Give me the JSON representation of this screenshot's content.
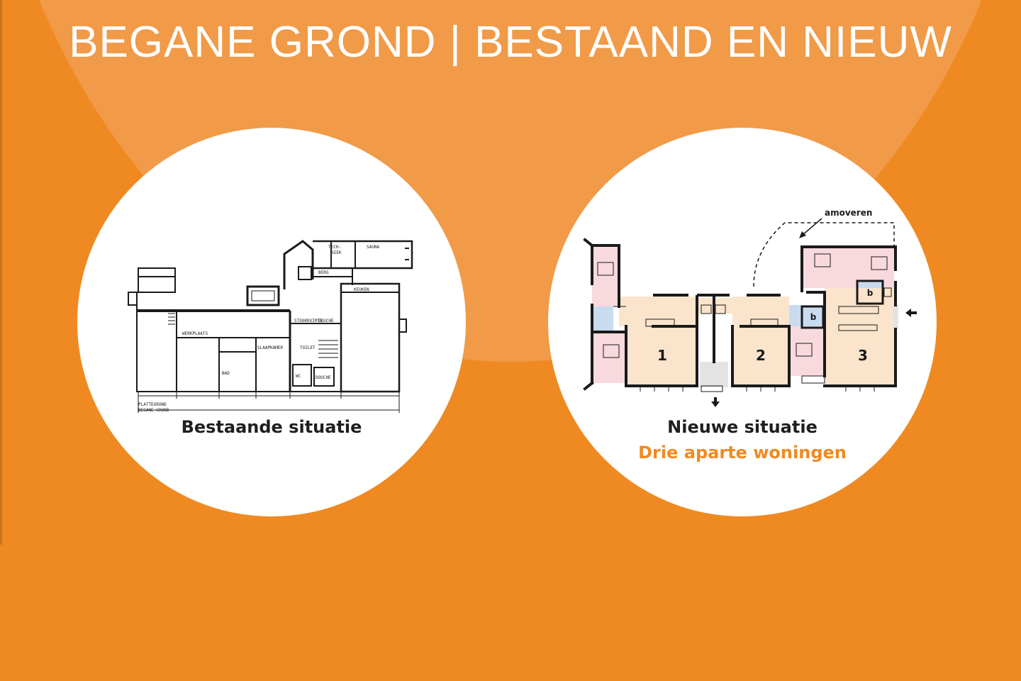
{
  "header": {
    "title": "BEGANE GROND | BESTAAND EN NIEUW"
  },
  "existing": {
    "caption": "Bestaande situatie",
    "room_labels": [
      "TECH-",
      "NIEK",
      "SAUNA",
      "BERG",
      "KEUKEN",
      "STOOKRUIMTE",
      "DOUCHE",
      "TOILET",
      "WC",
      "DOUCHE",
      "WERKPLAATS",
      "SLAAPKAMER",
      "BAD",
      "PLATTEGROND",
      "BEGANE GROND"
    ]
  },
  "new": {
    "caption": "Nieuwe situatie",
    "subcaption": "Drie aparte woningen",
    "annotation": "amoveren",
    "units": [
      "1",
      "2",
      "3"
    ],
    "bath_label": "b"
  },
  "colors": {
    "background": "#ef8a23",
    "glow": "#f19a48",
    "living": "#fbe4cc",
    "bedroom": "#f8d9dd",
    "bathroom": "#c8dbef",
    "hall": "#e3e3e3",
    "accent_text": "#ef8a23"
  }
}
